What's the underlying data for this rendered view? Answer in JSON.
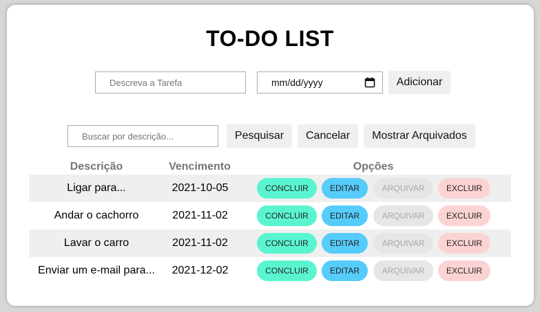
{
  "app": {
    "title": "TO-DO LIST"
  },
  "add_form": {
    "task_placeholder": "Descreva a Tarefa",
    "date_value": "mm/dd/yyyy",
    "add_label": "Adicionar"
  },
  "search_form": {
    "search_placeholder": "Buscar por descrição...",
    "search_label": "Pesquisar",
    "cancel_label": "Cancelar",
    "archived_label": "Mostrar Arquivados"
  },
  "table": {
    "headers": [
      "Descrição",
      "Vencimento",
      "Opções"
    ],
    "actions": {
      "concluir": "CONCLUIR",
      "editar": "EDITAR",
      "arquivar": "ARQUIVAR",
      "excluir": "EXCLUIR"
    },
    "rows": [
      {
        "description": "Ligar para...",
        "due": "2021-10-05"
      },
      {
        "description": "Andar o cachorro",
        "due": "2021-11-02"
      },
      {
        "description": "Lavar o carro",
        "due": "2021-11-02"
      },
      {
        "description": "Enviar um e-mail para...",
        "due": "2021-12-02"
      }
    ]
  },
  "colors": {
    "concluir": "#5af5d0",
    "editar": "#56ccfb",
    "arquivar": "#e6e6e6",
    "excluir": "#fcd3d3",
    "row_shade": "#efefef"
  },
  "icons": {
    "date_picker": "calendar-icon"
  }
}
